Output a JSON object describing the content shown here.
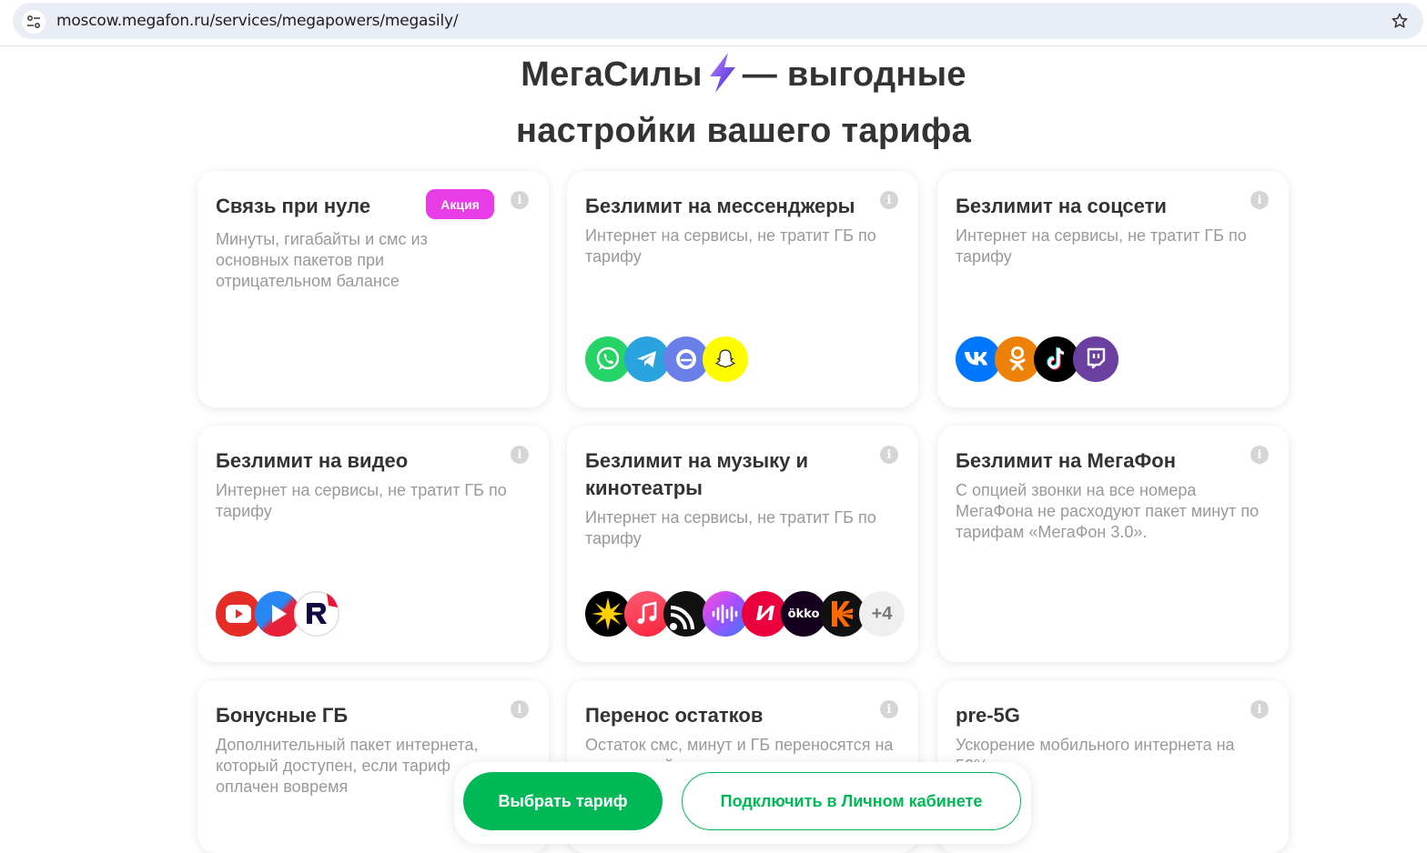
{
  "browser": {
    "url": "moscow.megafon.ru/services/megapowers/megasily/"
  },
  "heading": {
    "line1_before": "МегаСилы",
    "line1_after": "— выгодные",
    "line2": "настройки вашего тарифа"
  },
  "cards": [
    {
      "title": "Связь при нуле",
      "badge": "Акция",
      "desc": "Минуты, гигабайты и смс из основных пакетов при отрицательном балансе"
    },
    {
      "title": "Безлимит на мессенджеры",
      "desc": "Интернет на сервисы, не тратит ГБ по тарифу",
      "icons": [
        "whatsapp-icon",
        "telegram-icon",
        "messenger-icon",
        "snapchat-icon"
      ]
    },
    {
      "title": "Безлимит на соцсети",
      "desc": "Интернет на сервисы, не тратит ГБ по тарифу",
      "icons": [
        "vk-icon",
        "odnoklassniki-icon",
        "tiktok-icon",
        "twitch-icon"
      ]
    },
    {
      "title": "Безлимит на видео",
      "desc": "Интернет на сервисы, не тратит ГБ по тарифу",
      "icons": [
        "youtube-icon",
        "vk-video-icon",
        "rutube-icon"
      ]
    },
    {
      "title": "Безлимит на музыку и кинотеатры",
      "desc": "Интернет на сервисы, не тратит ГБ по тарифу",
      "icons": [
        "zvuk-icon",
        "apple-music-icon",
        "podcast-icon",
        "music-wave-icon",
        "ivi-icon",
        "okko-icon",
        "kinopoisk-icon"
      ],
      "more": "+4",
      "okko_label": "ökko"
    },
    {
      "title": "Безлимит на МегаФон",
      "desc": "С опцией звонки на все номера МегаФона не расходуют пакет минут по тарифам «МегаФон 3.0»."
    },
    {
      "title": "Бонусные ГБ",
      "desc": "Дополнительный пакет интернета, который доступен, если тариф оплачен вовремя"
    },
    {
      "title": "Перенос остатков",
      "desc": "Остаток смс, минут и ГБ переносятся на следующий месяц"
    },
    {
      "title": "pre-5G",
      "desc": "Ускорение мобильного интернета на 50%"
    }
  ],
  "actions": {
    "choose_tariff": "Выбрать тариф",
    "connect_cabinet": "Подключить в Личном кабинете"
  },
  "colors": {
    "brand_green": "#00b956",
    "promo_pink": "#e83ce6",
    "bolt_purple": "#731982"
  }
}
